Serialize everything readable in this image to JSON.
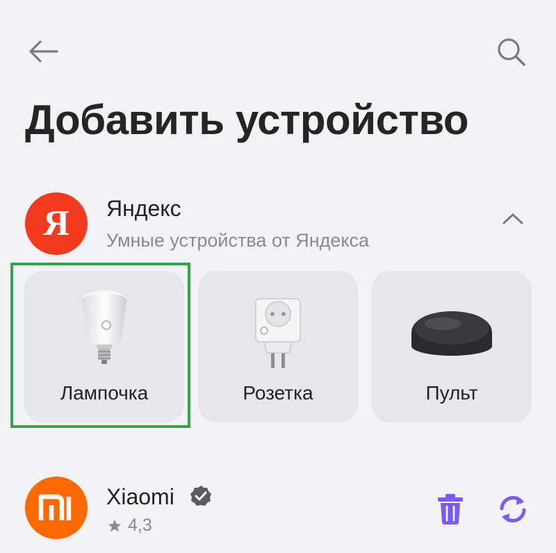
{
  "header": {
    "title": "Добавить устройство"
  },
  "brands": [
    {
      "name": "Яндекс",
      "subtitle": "Умные устройства от Яндекса",
      "logo_letter": "Я",
      "logo_color": "#f33a1f",
      "expanded": true,
      "devices": [
        {
          "label": "Лампочка",
          "icon": "lightbulb-icon",
          "selected": true
        },
        {
          "label": "Розетка",
          "icon": "smart-plug-icon",
          "selected": false
        },
        {
          "label": "Пульт",
          "icon": "remote-hub-icon",
          "selected": false
        }
      ]
    },
    {
      "name": "Xiaomi",
      "logo_text": "mi",
      "logo_color": "#ff6900",
      "verified": true,
      "rating": "4,3",
      "actions": [
        "trash-icon",
        "sync-icon"
      ]
    }
  ],
  "colors": {
    "background": "#f3f3f5",
    "card": "#e7e7ea",
    "selection_outline": "#2ba84a",
    "action_purple": "#7a5af8"
  }
}
